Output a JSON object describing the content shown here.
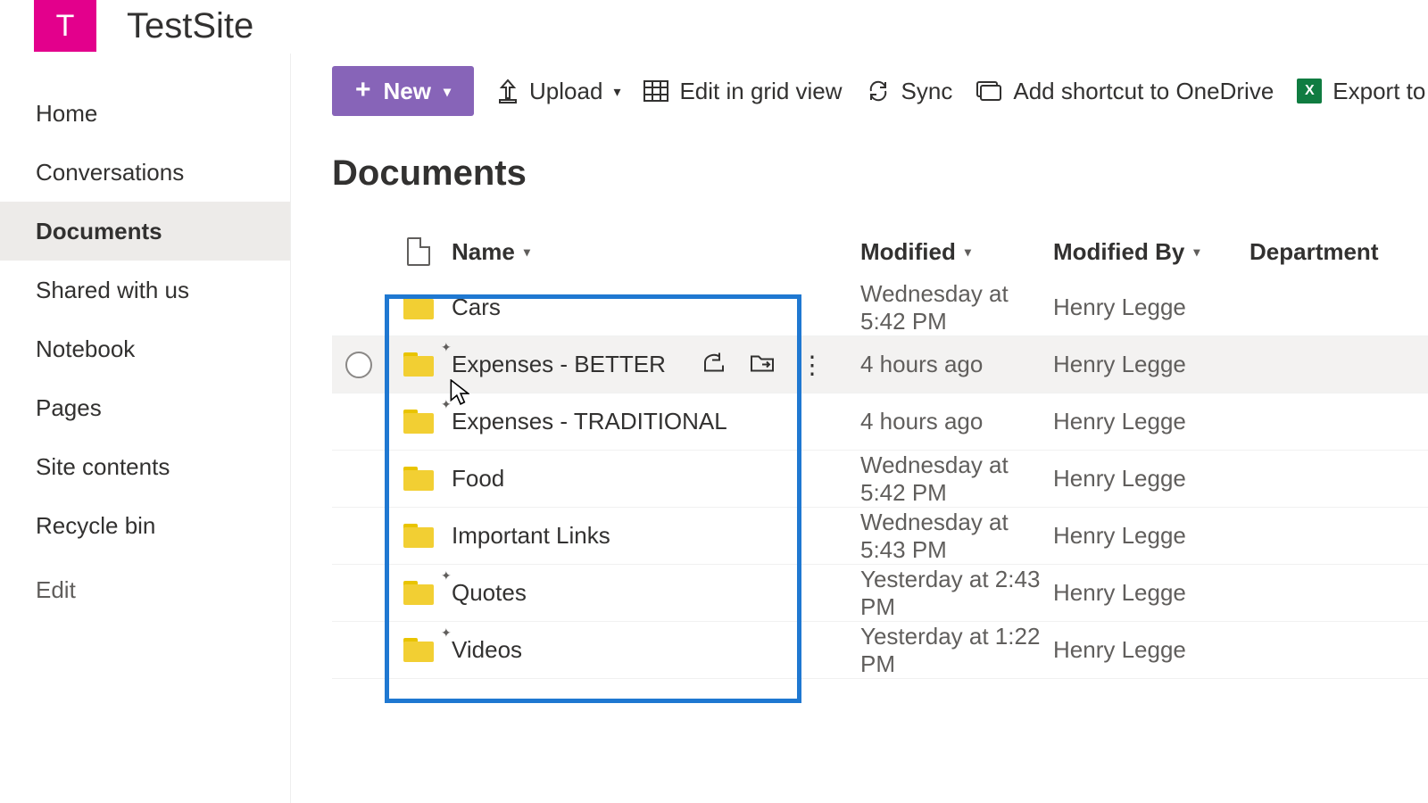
{
  "site": {
    "logo_letter": "T",
    "title": "TestSite"
  },
  "sidebar": {
    "items": [
      {
        "label": "Home",
        "selected": false
      },
      {
        "label": "Conversations",
        "selected": false
      },
      {
        "label": "Documents",
        "selected": true
      },
      {
        "label": "Shared with us",
        "selected": false
      },
      {
        "label": "Notebook",
        "selected": false
      },
      {
        "label": "Pages",
        "selected": false
      },
      {
        "label": "Site contents",
        "selected": false
      },
      {
        "label": "Recycle bin",
        "selected": false
      }
    ],
    "edit_label": "Edit"
  },
  "toolbar": {
    "new_label": "New",
    "upload_label": "Upload",
    "grid_label": "Edit in grid view",
    "sync_label": "Sync",
    "shortcut_label": "Add shortcut to OneDrive",
    "export_label": "Export to Excel"
  },
  "library": {
    "title": "Documents"
  },
  "columns": {
    "name": "Name",
    "modified": "Modified",
    "modified_by": "Modified By",
    "department": "Department"
  },
  "rows": [
    {
      "name": "Cars",
      "modified": "Wednesday at 5:42 PM",
      "modified_by": "Henry Legge",
      "hover": false,
      "sync_mark": false
    },
    {
      "name": "Expenses - BETTER",
      "modified": "4 hours ago",
      "modified_by": "Henry Legge",
      "hover": true,
      "sync_mark": true
    },
    {
      "name": "Expenses - TRADITIONAL",
      "modified": "4 hours ago",
      "modified_by": "Henry Legge",
      "hover": false,
      "sync_mark": true
    },
    {
      "name": "Food",
      "modified": "Wednesday at 5:42 PM",
      "modified_by": "Henry Legge",
      "hover": false,
      "sync_mark": false
    },
    {
      "name": "Important Links",
      "modified": "Wednesday at 5:43 PM",
      "modified_by": "Henry Legge",
      "hover": false,
      "sync_mark": false
    },
    {
      "name": "Quotes",
      "modified": "Yesterday at 2:43 PM",
      "modified_by": "Henry Legge",
      "hover": false,
      "sync_mark": true
    },
    {
      "name": "Videos",
      "modified": "Yesterday at 1:22 PM",
      "modified_by": "Henry Legge",
      "hover": false,
      "sync_mark": true
    }
  ]
}
